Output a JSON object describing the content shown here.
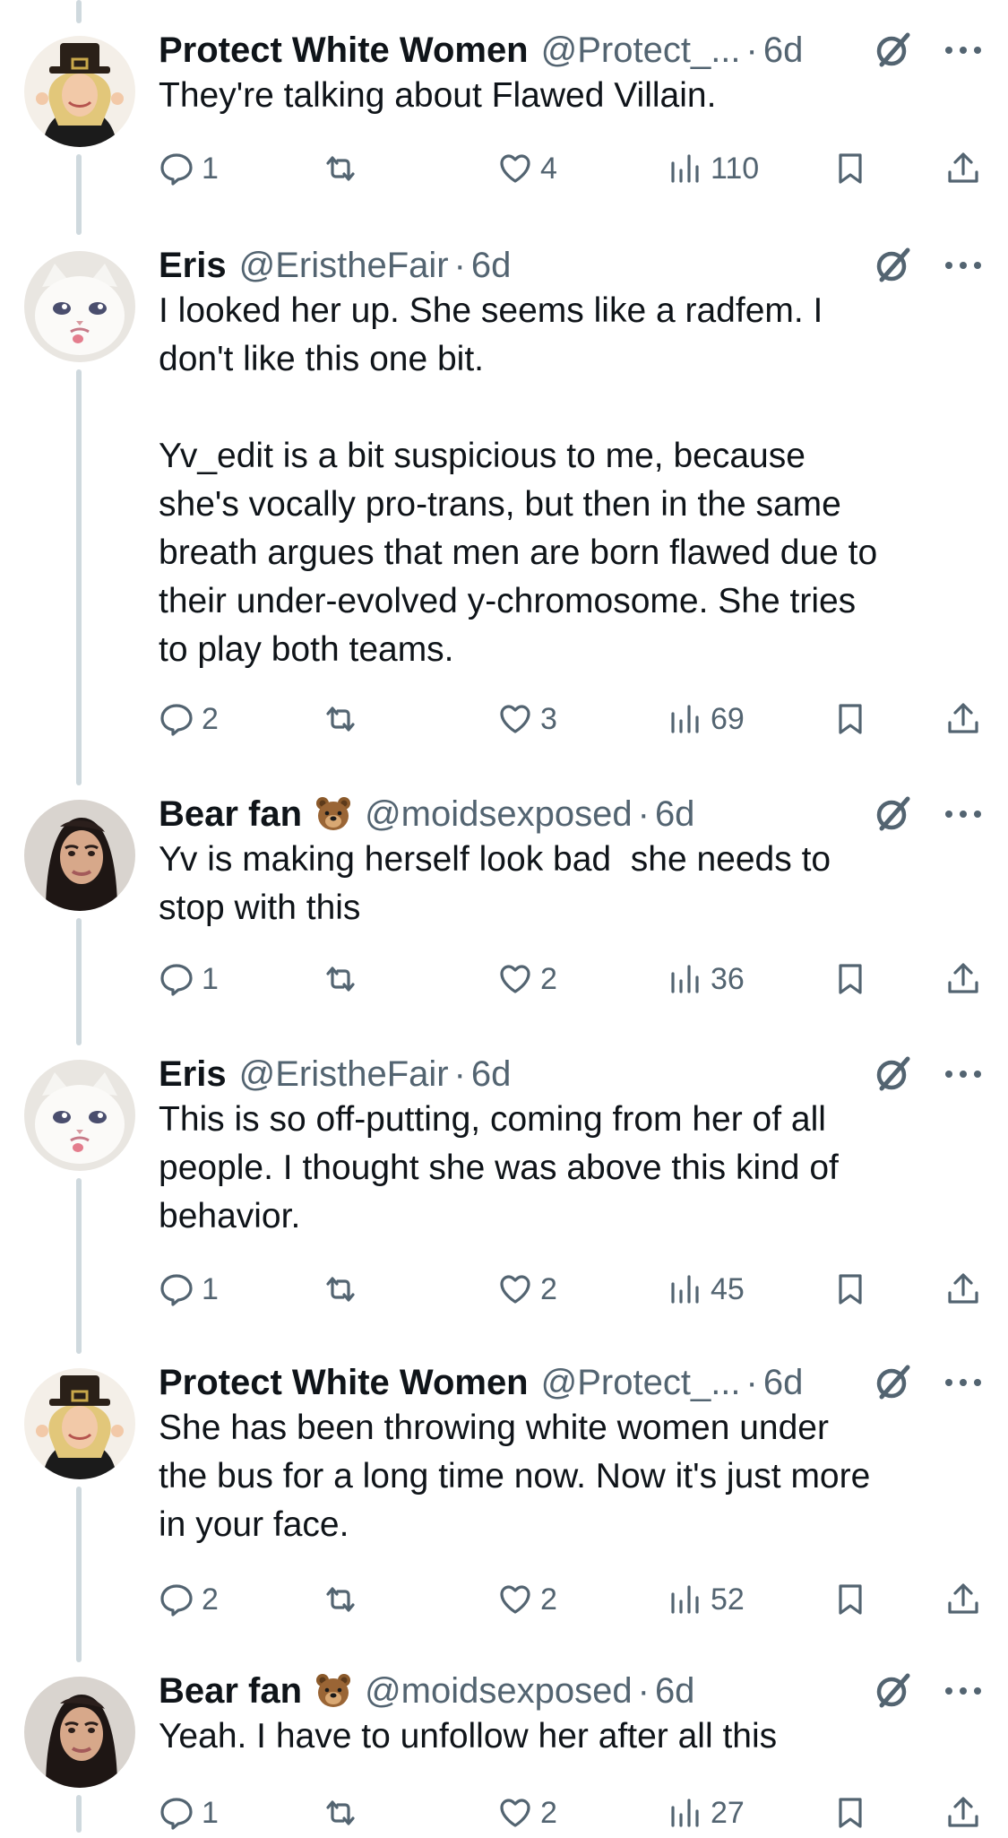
{
  "tweets": [
    {
      "name": "Protect White Women",
      "emoji": "",
      "handle": "@Protect_...",
      "time": "6d",
      "text": "They're talking about Flawed Villain.",
      "replies": "1",
      "retweets": "",
      "likes": "4",
      "views": "110",
      "avatar": "blonde-woman-pilgrim-hat"
    },
    {
      "name": "Eris",
      "emoji": "",
      "handle": "@EristheFair",
      "time": "6d",
      "text": "I looked her up. She seems like a radfem. I\ndon't like this one bit.\n\nYv_edit is a bit suspicious to me, because\nshe's vocally pro-trans, but then in the same\nbreath argues that men are born flawed due to\ntheir under-evolved y-chromosome. She tries\nto play both teams.",
      "replies": "2",
      "retweets": "",
      "likes": "3",
      "views": "69",
      "avatar": "white-cat"
    },
    {
      "name": "Bear fan",
      "emoji": "bear-emoji",
      "handle": "@moidsexposed",
      "time": "6d",
      "text": "Yv is making herself look bad  she needs to\nstop with this",
      "replies": "1",
      "retweets": "",
      "likes": "2",
      "views": "36",
      "avatar": "dark-haired-woman"
    },
    {
      "name": "Eris",
      "emoji": "",
      "handle": "@EristheFair",
      "time": "6d",
      "text": "This is so off-putting, coming from her of all\npeople. I thought she was above this kind of\nbehavior.",
      "replies": "1",
      "retweets": "",
      "likes": "2",
      "views": "45",
      "avatar": "white-cat"
    },
    {
      "name": "Protect White Women",
      "emoji": "",
      "handle": "@Protect_...",
      "time": "6d",
      "text": "She has been throwing white women under\nthe bus for a long time now. Now it's just more\nin your face.",
      "replies": "2",
      "retweets": "",
      "likes": "2",
      "views": "52",
      "avatar": "blonde-woman-pilgrim-hat"
    },
    {
      "name": "Bear fan",
      "emoji": "bear-emoji",
      "handle": "@moidsexposed",
      "time": "6d",
      "text": "Yeah. I have to unfollow her after all this",
      "replies": "1",
      "retweets": "",
      "likes": "2",
      "views": "27",
      "avatar": "dark-haired-woman"
    }
  ],
  "dot": "·",
  "colors": {
    "text": "#0f1419",
    "secondary": "#536471",
    "rail": "#cfd9de"
  }
}
